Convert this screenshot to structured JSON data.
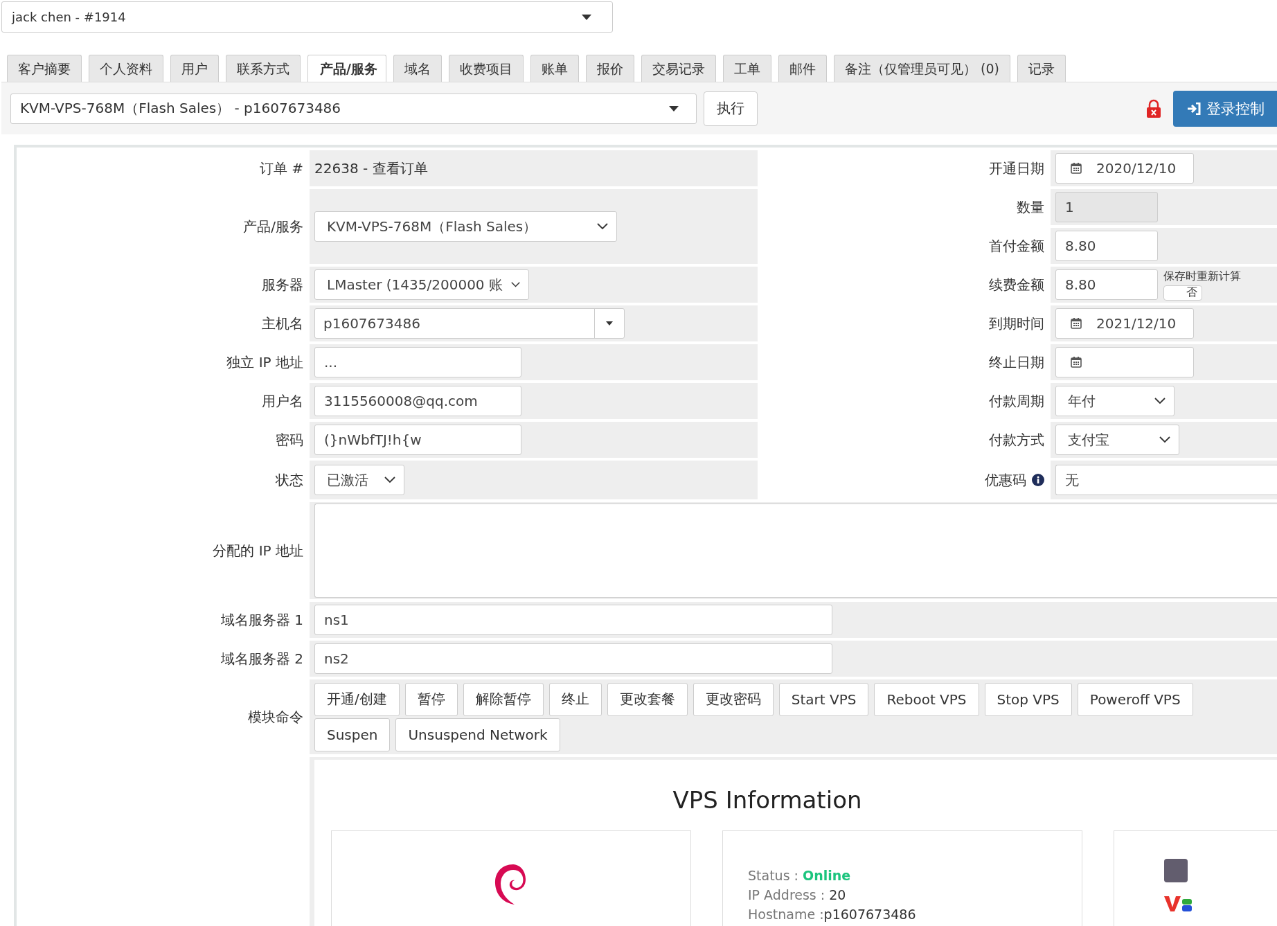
{
  "client_select": {
    "value": "jack chen - #1914"
  },
  "tabs": [
    {
      "label": "客户摘要",
      "selected": false
    },
    {
      "label": "个人资料",
      "selected": false
    },
    {
      "label": "用户",
      "selected": false
    },
    {
      "label": "联系方式",
      "selected": false
    },
    {
      "label": "产品/服务",
      "selected": true
    },
    {
      "label": "域名",
      "selected": false
    },
    {
      "label": "收费项目",
      "selected": false
    },
    {
      "label": "账单",
      "selected": false
    },
    {
      "label": "报价",
      "selected": false
    },
    {
      "label": "交易记录",
      "selected": false
    },
    {
      "label": "工单",
      "selected": false
    },
    {
      "label": "邮件",
      "selected": false
    },
    {
      "label": "备注（仅管理员可见） (0)",
      "selected": false
    },
    {
      "label": "记录",
      "selected": false
    }
  ],
  "service_select": {
    "value": "KVM-VPS-768M（Flash Sales） - p1607673486"
  },
  "run_button": "执行",
  "login_button": "登录控制",
  "left_fields": [
    {
      "kind": "text",
      "label": "订单 #",
      "value": "22638 - 查看订单"
    },
    {
      "kind": "select",
      "label": "产品/服务",
      "value": "KVM-VPS-768M（Flash Sales）"
    },
    {
      "kind": "select",
      "label": "服务器",
      "value": "LMaster (1435/200000 账"
    },
    {
      "kind": "combo",
      "label": "主机名",
      "value": "p1607673486"
    },
    {
      "kind": "input",
      "label": "独立 IP 地址",
      "value": "..."
    },
    {
      "kind": "input",
      "label": "用户名",
      "value": "3115560008@qq.com"
    },
    {
      "kind": "input",
      "label": "密码",
      "value": "(}nWbfTJ!h{w"
    },
    {
      "kind": "select",
      "label": "状态",
      "value": "已激活"
    }
  ],
  "right_fields": [
    {
      "kind": "date",
      "label": "开通日期",
      "value": "2020/12/10"
    },
    {
      "kind": "readonly",
      "label": "数量",
      "value": "1"
    },
    {
      "kind": "input",
      "label": "首付金额",
      "value": "8.80"
    },
    {
      "kind": "recalc",
      "label": "续费金额",
      "value": "8.80",
      "note": "保存时重新计算",
      "toggle": {
        "label": "否",
        "on": false
      }
    },
    {
      "kind": "date",
      "label": "到期时间",
      "value": "2021/12/10"
    },
    {
      "kind": "date",
      "label": "终止日期"
    },
    {
      "kind": "select",
      "label": "付款周期",
      "value": "年付"
    },
    {
      "kind": "select",
      "label": "付款方式",
      "value": "支付宝"
    },
    {
      "kind": "info",
      "label": "优惠码",
      "value": "无"
    }
  ],
  "assigned_ips": {
    "label": "分配的 IP 地址"
  },
  "nameservers": [
    {
      "label": "域名服务器 1",
      "value": "ns1"
    },
    {
      "label": "域名服务器 2",
      "value": "ns2"
    }
  ],
  "module_commands": {
    "label": "模块命令",
    "buttons": [
      "开通/创建",
      "暂停",
      "解除暂停",
      "终止",
      "更改套餐",
      "更改密码",
      "Start VPS",
      "Reboot VPS",
      "Stop VPS",
      "Poweroff VPS",
      "Suspen",
      "Unsuspend Network"
    ]
  },
  "vps_info": {
    "title": "VPS Information",
    "status_label": "Status :",
    "status": "Online",
    "ip_label": "IP Address :",
    "ip": "20",
    "hostname_label": "Hostname :",
    "hostname": "p1607673486"
  }
}
